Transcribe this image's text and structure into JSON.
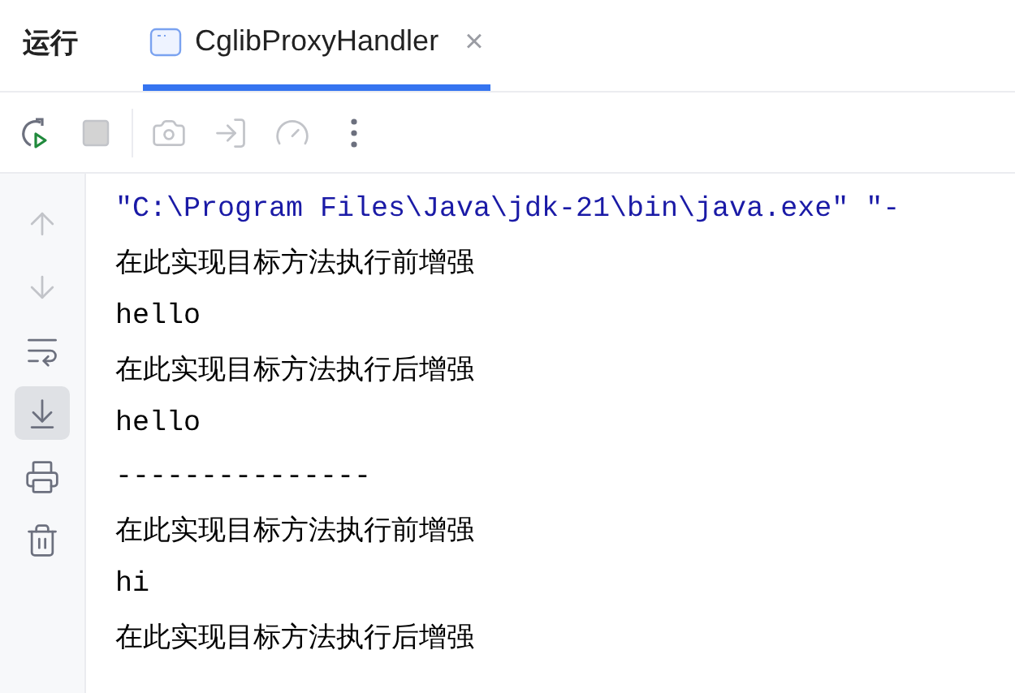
{
  "header": {
    "title": "运行",
    "tabs": [
      {
        "label": "CglibProxyHandler",
        "selected": true,
        "close": "×"
      }
    ]
  },
  "toolbar": [
    {
      "kind": "rerun",
      "disabled": false
    },
    {
      "kind": "stop",
      "disabled": true
    },
    {
      "kind": "camera",
      "disabled": true
    },
    {
      "kind": "enter",
      "disabled": true
    },
    {
      "kind": "gauge",
      "disabled": true
    },
    {
      "kind": "more",
      "disabled": false
    }
  ],
  "sidebar": [
    {
      "kind": "up",
      "disabled": true,
      "selected": false
    },
    {
      "kind": "down",
      "disabled": true,
      "selected": false
    },
    {
      "kind": "wrap",
      "disabled": false,
      "selected": false
    },
    {
      "kind": "scroll-end",
      "disabled": false,
      "selected": true
    },
    {
      "kind": "print",
      "disabled": false,
      "selected": false
    },
    {
      "kind": "trash",
      "disabled": false,
      "selected": false
    }
  ],
  "console": [
    {
      "kind": "command",
      "text": "\"C:\\Program Files\\Java\\jdk-21\\bin\\java.exe\" \"-"
    },
    {
      "kind": "cjk",
      "text": "在此实现目标方法执行前增强"
    },
    {
      "kind": "out",
      "text": "hello"
    },
    {
      "kind": "cjk",
      "text": "在此实现目标方法执行后增强"
    },
    {
      "kind": "out",
      "text": "hello"
    },
    {
      "kind": "out",
      "text": "---------------"
    },
    {
      "kind": "cjk",
      "text": "在此实现目标方法执行前增强"
    },
    {
      "kind": "out",
      "text": "hi"
    },
    {
      "kind": "cjk",
      "text": "在此实现目标方法执行后增强"
    }
  ]
}
